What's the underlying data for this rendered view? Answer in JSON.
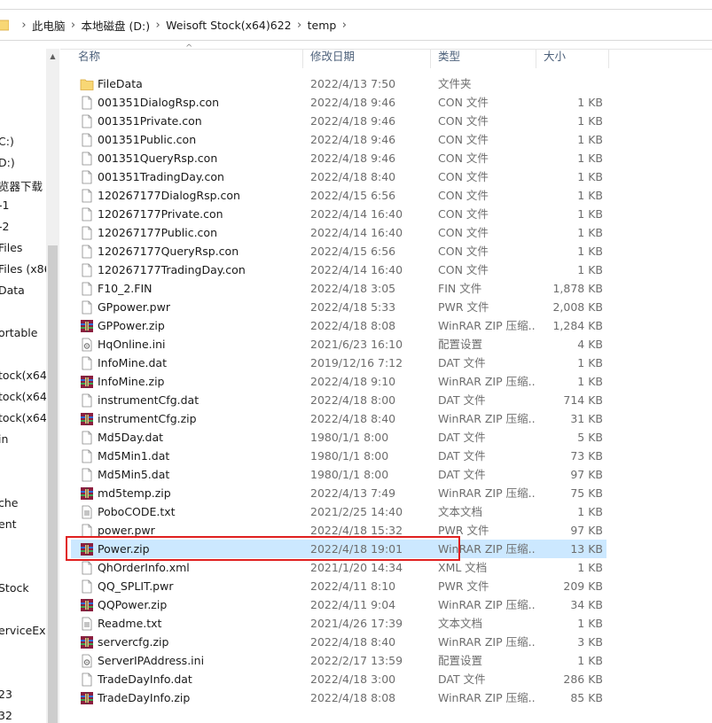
{
  "address": {
    "crumbs": [
      "此电脑",
      "本地磁盘 (D:)",
      "Weisoft Stock(x64)622",
      "temp"
    ]
  },
  "nav": {
    "items": [
      "C:)",
      "D:)",
      "览器下载",
      "-1",
      "-2",
      "Files",
      "Files (x86",
      "Data",
      "ortable",
      "tock(x64",
      "tock(x64",
      "tock(x64",
      "in",
      "che",
      "ent",
      "Stock",
      "erviceEx",
      "23",
      "32"
    ]
  },
  "columns": {
    "name": "名称",
    "date": "修改日期",
    "type": "类型",
    "size": "大小"
  },
  "files": [
    {
      "name": "FileData",
      "date": "2022/4/13 7:50",
      "type": "文件夹",
      "size": "",
      "icon": "folder-icon"
    },
    {
      "name": "001351DialogRsp.con",
      "date": "2022/4/18 9:46",
      "type": "CON 文件",
      "size": "1 KB",
      "icon": "file-icon"
    },
    {
      "name": "001351Private.con",
      "date": "2022/4/18 9:46",
      "type": "CON 文件",
      "size": "1 KB",
      "icon": "file-icon"
    },
    {
      "name": "001351Public.con",
      "date": "2022/4/18 9:46",
      "type": "CON 文件",
      "size": "1 KB",
      "icon": "file-icon"
    },
    {
      "name": "001351QueryRsp.con",
      "date": "2022/4/18 9:46",
      "type": "CON 文件",
      "size": "1 KB",
      "icon": "file-icon"
    },
    {
      "name": "001351TradingDay.con",
      "date": "2022/4/18 8:40",
      "type": "CON 文件",
      "size": "1 KB",
      "icon": "file-icon"
    },
    {
      "name": "120267177DialogRsp.con",
      "date": "2022/4/15 6:56",
      "type": "CON 文件",
      "size": "1 KB",
      "icon": "file-icon"
    },
    {
      "name": "120267177Private.con",
      "date": "2022/4/14 16:40",
      "type": "CON 文件",
      "size": "1 KB",
      "icon": "file-icon"
    },
    {
      "name": "120267177Public.con",
      "date": "2022/4/14 16:40",
      "type": "CON 文件",
      "size": "1 KB",
      "icon": "file-icon"
    },
    {
      "name": "120267177QueryRsp.con",
      "date": "2022/4/15 6:56",
      "type": "CON 文件",
      "size": "1 KB",
      "icon": "file-icon"
    },
    {
      "name": "120267177TradingDay.con",
      "date": "2022/4/14 16:40",
      "type": "CON 文件",
      "size": "1 KB",
      "icon": "file-icon"
    },
    {
      "name": "F10_2.FIN",
      "date": "2022/4/18 3:05",
      "type": "FIN 文件",
      "size": "1,878 KB",
      "icon": "file-icon"
    },
    {
      "name": "GPpower.pwr",
      "date": "2022/4/18 5:33",
      "type": "PWR 文件",
      "size": "2,008 KB",
      "icon": "file-icon"
    },
    {
      "name": "GPPower.zip",
      "date": "2022/4/18 8:08",
      "type": "WinRAR ZIP 压缩...",
      "size": "1,284 KB",
      "icon": "winrar-icon"
    },
    {
      "name": "HqOnline.ini",
      "date": "2021/6/23 16:10",
      "type": "配置设置",
      "size": "4 KB",
      "icon": "config-icon"
    },
    {
      "name": "InfoMine.dat",
      "date": "2019/12/16 7:12",
      "type": "DAT 文件",
      "size": "1 KB",
      "icon": "file-icon"
    },
    {
      "name": "InfoMine.zip",
      "date": "2022/4/18 9:10",
      "type": "WinRAR ZIP 压缩...",
      "size": "1 KB",
      "icon": "winrar-icon"
    },
    {
      "name": "instrumentCfg.dat",
      "date": "2022/4/18 8:00",
      "type": "DAT 文件",
      "size": "714 KB",
      "icon": "file-icon"
    },
    {
      "name": "instrumentCfg.zip",
      "date": "2022/4/18 8:40",
      "type": "WinRAR ZIP 压缩...",
      "size": "31 KB",
      "icon": "winrar-icon"
    },
    {
      "name": "Md5Day.dat",
      "date": "1980/1/1 8:00",
      "type": "DAT 文件",
      "size": "5 KB",
      "icon": "file-icon"
    },
    {
      "name": "Md5Min1.dat",
      "date": "1980/1/1 8:00",
      "type": "DAT 文件",
      "size": "73 KB",
      "icon": "file-icon"
    },
    {
      "name": "Md5Min5.dat",
      "date": "1980/1/1 8:00",
      "type": "DAT 文件",
      "size": "97 KB",
      "icon": "file-icon"
    },
    {
      "name": "md5temp.zip",
      "date": "2022/4/13 7:49",
      "type": "WinRAR ZIP 压缩...",
      "size": "75 KB",
      "icon": "winrar-icon"
    },
    {
      "name": "PoboCODE.txt",
      "date": "2021/2/25 14:40",
      "type": "文本文档",
      "size": "1 KB",
      "icon": "text-icon"
    },
    {
      "name": "power.pwr",
      "date": "2022/4/18 15:32",
      "type": "PWR 文件",
      "size": "97 KB",
      "icon": "file-icon"
    },
    {
      "name": "Power.zip",
      "date": "2022/4/18 19:01",
      "type": "WinRAR ZIP 压缩...",
      "size": "13 KB",
      "icon": "winrar-icon",
      "selected": true
    },
    {
      "name": "QhOrderInfo.xml",
      "date": "2021/1/20 14:34",
      "type": "XML 文档",
      "size": "1 KB",
      "icon": "file-icon"
    },
    {
      "name": "QQ_SPLIT.pwr",
      "date": "2022/4/11 8:10",
      "type": "PWR 文件",
      "size": "209 KB",
      "icon": "file-icon"
    },
    {
      "name": "QQPower.zip",
      "date": "2022/4/11 9:04",
      "type": "WinRAR ZIP 压缩...",
      "size": "34 KB",
      "icon": "winrar-icon"
    },
    {
      "name": "Readme.txt",
      "date": "2021/4/26 17:39",
      "type": "文本文档",
      "size": "1 KB",
      "icon": "text-icon"
    },
    {
      "name": "servercfg.zip",
      "date": "2022/4/18 8:40",
      "type": "WinRAR ZIP 压缩...",
      "size": "3 KB",
      "icon": "winrar-icon"
    },
    {
      "name": "ServerIPAddress.ini",
      "date": "2022/2/17 13:59",
      "type": "配置设置",
      "size": "1 KB",
      "icon": "config-icon"
    },
    {
      "name": "TradeDayInfo.dat",
      "date": "2022/4/18 3:00",
      "type": "DAT 文件",
      "size": "286 KB",
      "icon": "file-icon"
    },
    {
      "name": "TradeDayInfo.zip",
      "date": "2022/4/18 8:08",
      "type": "WinRAR ZIP 压缩...",
      "size": "85 KB",
      "icon": "winrar-icon"
    }
  ],
  "colors": {
    "selection": "#cce8ff",
    "highlight_box": "#e02020",
    "folder": "#f8d775"
  }
}
